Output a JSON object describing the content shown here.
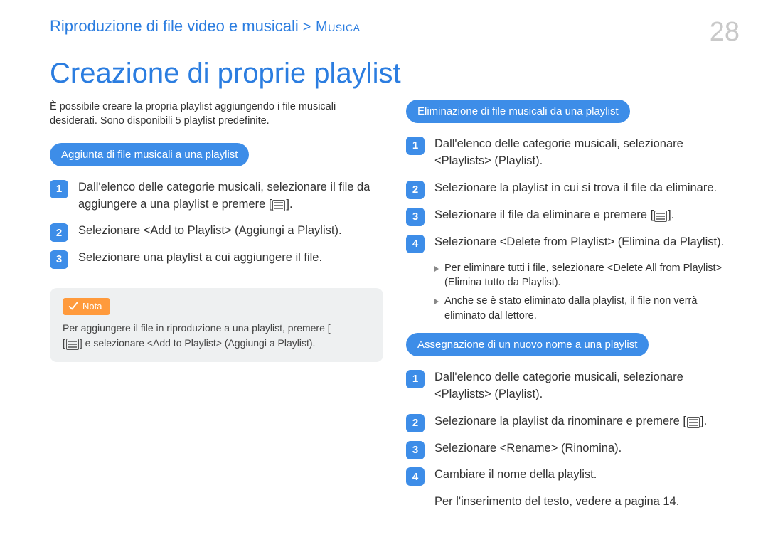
{
  "header": {
    "breadcrumb_main": "Riproduzione di file video e musicali",
    "breadcrumb_sub": " > Musica",
    "page_number": "28"
  },
  "title": "Creazione di proprie playlist",
  "left": {
    "intro": "È possibile creare la propria playlist aggiungendo i file musicali desiderati. Sono disponibili 5 playlist predefinite.",
    "pill": "Aggiunta di file musicali a una playlist",
    "steps": [
      {
        "num": "1",
        "text_a": "Dall'elenco delle categorie musicali, selezionare il file da aggiungere a una playlist e premere [",
        "text_b": "]."
      },
      {
        "num": "2",
        "text_a": "Selezionare <Add to Playlist> (Aggiungi a Playlist)."
      },
      {
        "num": "3",
        "text_a": "Selezionare una playlist a cui aggiungere il file."
      }
    ],
    "note": {
      "label": "Nota",
      "line_a": "Per aggiungere il file in riproduzione a una playlist, premere [",
      "line_b": "] e selezionare <Add to Playlist> (Aggiungi a Playlist)."
    }
  },
  "right": {
    "section1": {
      "pill": "Eliminazione di file musicali da una playlist",
      "steps": [
        {
          "num": "1",
          "text_a": "Dall'elenco delle categorie musicali, selezionare <Playlists> (Playlist)."
        },
        {
          "num": "2",
          "text_a": "Selezionare la playlist in cui si trova il file da eliminare."
        },
        {
          "num": "3",
          "text_a": "Selezionare il file da eliminare e premere [",
          "text_b": "]."
        },
        {
          "num": "4",
          "text_a": "Selezionare <Delete from Playlist> (Elimina da Playlist)."
        }
      ],
      "subnotes": [
        "Per eliminare tutti i file, selezionare <Delete All from Playlist> (Elimina tutto da Playlist).",
        "Anche se è stato eliminato dalla playlist, il file non verrà eliminato dal lettore."
      ]
    },
    "section2": {
      "pill": "Assegnazione di un nuovo nome a una playlist",
      "steps": [
        {
          "num": "1",
          "text_a": "Dall'elenco delle categorie musicali, selezionare <Playlists> (Playlist)."
        },
        {
          "num": "2",
          "text_a": "Selezionare la playlist da rinominare e premere [",
          "text_b": "]."
        },
        {
          "num": "3",
          "text_a": "Selezionare <Rename> (Rinomina)."
        },
        {
          "num": "4",
          "text_a": "Cambiare il nome della playlist."
        }
      ],
      "followup": "Per l'inserimento del testo, vedere a pagina 14."
    }
  }
}
